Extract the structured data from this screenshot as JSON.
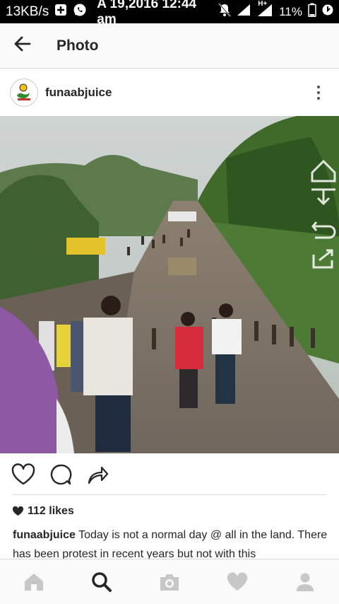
{
  "status_bar": {
    "network_speed": "13KB/s",
    "datetime": "A 19,2016 12:44 am",
    "network_type": "H+",
    "battery": "11%",
    "icons": [
      "plus-box-icon",
      "whatsapp-icon",
      "mute-icon",
      "signal-icon",
      "signal-h-plus-icon",
      "battery-icon",
      "data-saver-icon"
    ]
  },
  "app_bar": {
    "title": "Photo"
  },
  "post": {
    "username": "funaabjuice",
    "likes": "112 likes",
    "caption_user": "funaabjuice",
    "caption_text": "Today is not a normal day @ all in the land. There has been protest in recent years but not with this"
  },
  "photo_overlay": {
    "icons": [
      "home-outline-icon",
      "download-icon",
      "undo-icon",
      "share-external-icon"
    ]
  },
  "actions": {
    "icons": [
      "heart-icon",
      "comment-icon",
      "share-icon"
    ]
  },
  "bottom_nav": {
    "items": [
      "home-icon",
      "search-icon",
      "camera-icon",
      "heart-icon",
      "profile-icon"
    ],
    "active": "search-icon"
  },
  "colors": {
    "status_bar_bg": "#000000",
    "app_bar_bg": "#fafafa",
    "text": "#262626",
    "nav_inactive": "#c7c7c7",
    "divider": "#dbdbdb"
  }
}
